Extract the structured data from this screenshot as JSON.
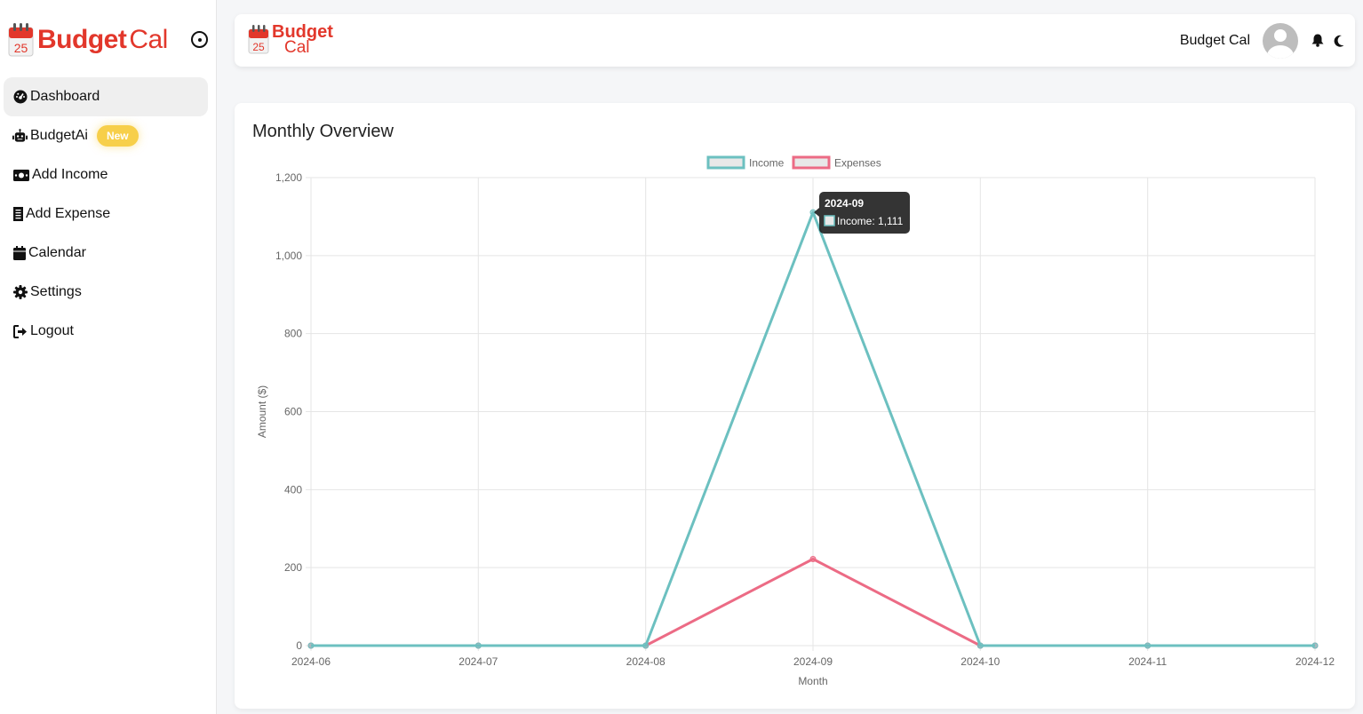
{
  "sidebar": {
    "brand": {
      "bold": "Budget",
      "light": "Cal",
      "calendar_day": "25"
    },
    "items": [
      {
        "label": "Dashboard",
        "icon": "gauge-icon",
        "active": true
      },
      {
        "label": "BudgetAi",
        "icon": "robot-icon",
        "badge": "New"
      },
      {
        "label": "Add Income",
        "icon": "money-bill-icon"
      },
      {
        "label": "Add Expense",
        "icon": "receipt-icon"
      },
      {
        "label": "Calendar",
        "icon": "calendar-icon"
      },
      {
        "label": "Settings",
        "icon": "gear-icon"
      },
      {
        "label": "Logout",
        "icon": "logout-icon"
      }
    ]
  },
  "header": {
    "brand": {
      "line1": "Budget",
      "line2": "Cal",
      "calendar_day": "25"
    },
    "username": "Budget Cal",
    "icons": [
      "bell-icon",
      "moon-icon"
    ]
  },
  "card": {
    "title": "Monthly Overview"
  },
  "colors": {
    "income": "#6cc0c0",
    "expenses": "#ec6b85",
    "brand": "#e2372b",
    "badge": "#f7cf4a"
  },
  "chart_data": {
    "type": "line",
    "title": "",
    "xlabel": "Month",
    "ylabel": "Amount ($)",
    "categories": [
      "2024-06",
      "2024-07",
      "2024-08",
      "2024-09",
      "2024-10",
      "2024-11",
      "2024-12"
    ],
    "series": [
      {
        "name": "Income",
        "values": [
          0,
          0,
          0,
          1111,
          0,
          0,
          0
        ]
      },
      {
        "name": "Expenses",
        "values": [
          0,
          0,
          0,
          222,
          0,
          0,
          0
        ]
      }
    ],
    "ylim": [
      0,
      1200
    ],
    "yticks": [
      0,
      200,
      400,
      600,
      800,
      1000,
      1200
    ],
    "ytick_labels": [
      "0",
      "200",
      "400",
      "600",
      "800",
      "1,000",
      "1,200"
    ],
    "grid": true,
    "legend": "top-center",
    "tooltip": {
      "title": "2024-09",
      "label": "Income: 1,111"
    }
  }
}
